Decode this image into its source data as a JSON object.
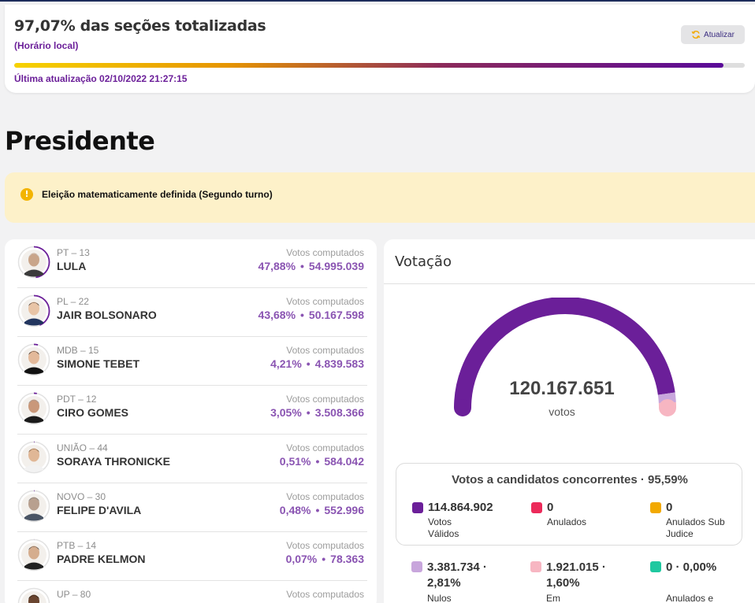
{
  "status": {
    "title": "97,07% das seções totalizadas",
    "subtitle": "(Horário local)",
    "refresh_label": "Atualizar",
    "progress": 0.9707,
    "last_update": "Última atualização 02/10/2022 21:27:15"
  },
  "page_title": "Presidente",
  "alert": {
    "text": "Eleição matematicamente definida (Segundo turno)",
    "icon": "info-icon"
  },
  "candidates": [
    {
      "party": "PT – 13",
      "name": "LULA",
      "votes_label": "Votos computados",
      "percent": "47,88%",
      "votes": "54.995.039",
      "ring": 0.4788
    },
    {
      "party": "PL – 22",
      "name": "JAIR BOLSONARO",
      "votes_label": "Votos computados",
      "percent": "43,68%",
      "votes": "50.167.598",
      "ring": 0.4368
    },
    {
      "party": "MDB – 15",
      "name": "SIMONE TEBET",
      "votes_label": "Votos computados",
      "percent": "4,21%",
      "votes": "4.839.583",
      "ring": 0.0421
    },
    {
      "party": "PDT – 12",
      "name": "CIRO GOMES",
      "votes_label": "Votos computados",
      "percent": "3,05%",
      "votes": "3.508.366",
      "ring": 0.0305
    },
    {
      "party": "UNIÃO – 44",
      "name": "SORAYA THRONICKE",
      "votes_label": "Votos computados",
      "percent": "0,51%",
      "votes": "584.042",
      "ring": 0.0051
    },
    {
      "party": "NOVO – 30",
      "name": "FELIPE D'AVILA",
      "votes_label": "Votos computados",
      "percent": "0,48%",
      "votes": "552.996",
      "ring": 0.0048
    },
    {
      "party": "PTB – 14",
      "name": "PADRE KELMON",
      "votes_label": "Votos computados",
      "percent": "0,07%",
      "votes": "78.363",
      "ring": 0.0007
    },
    {
      "party": "UP – 80",
      "name": "",
      "votes_label": "Votos computados",
      "percent": "",
      "votes": "",
      "ring": 0
    }
  ],
  "votacao": {
    "title": "Votação",
    "total": "120.167.651",
    "unit": "votos",
    "gauge": {
      "valid_share": 0.9559,
      "null_share": 0.0281,
      "blank_share": 0.016
    },
    "concorrentes": {
      "title": "Votos a candidatos concorrentes · 95,59%",
      "stats": [
        {
          "value": "114.864.902",
          "label": "Votos Válidos",
          "color": "#6b1f99"
        },
        {
          "value": "0",
          "label": "Anulados",
          "color": "#ec2a5a"
        },
        {
          "value": "0",
          "label": "Anulados Sub Judice",
          "color": "#f2a900"
        }
      ]
    },
    "others": [
      {
        "value": "3.381.734 · 2,81%",
        "label": "Nulos",
        "color": "#c8a6dc"
      },
      {
        "value": "1.921.015 · 1,60%",
        "label": "Em Branco",
        "color": "#f7b6c2"
      },
      {
        "value": "0 · 0,00%",
        "label": "Anulados e apurados em separado",
        "color": "#1fc8a0"
      }
    ]
  },
  "colors": {
    "accent": "#6b1f99",
    "light_accent": "#c8a6dc",
    "pink": "#f7b6c2"
  }
}
